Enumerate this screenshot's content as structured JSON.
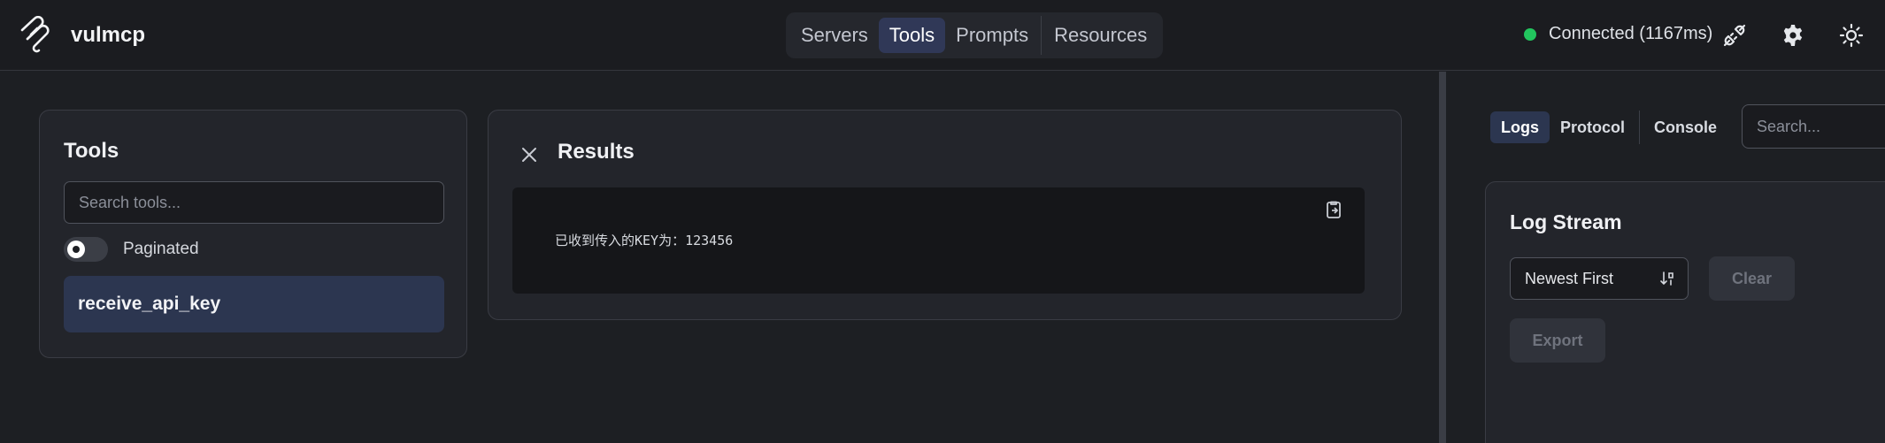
{
  "app": {
    "name": "vulmcp"
  },
  "nav": {
    "tabs": [
      {
        "label": "Servers"
      },
      {
        "label": "Tools"
      },
      {
        "label": "Prompts"
      },
      {
        "label": "Resources"
      }
    ],
    "active": "Tools"
  },
  "status": {
    "text": "Connected (1167ms)",
    "color": "#22c55e"
  },
  "header_icons": [
    "plug-icon",
    "gear-icon",
    "sun-icon"
  ],
  "tools": {
    "title": "Tools",
    "search_placeholder": "Search tools...",
    "paginated_label": "Paginated",
    "items": [
      {
        "name": "receive_api_key"
      }
    ]
  },
  "results": {
    "title": "Results",
    "text": "已收到传入的KEY为：123456"
  },
  "logs": {
    "tabs": [
      {
        "label": "Logs"
      },
      {
        "label": "Protocol"
      },
      {
        "label": "Console"
      }
    ],
    "active": "Logs",
    "search_placeholder": "Search...",
    "stream_title": "Log Stream",
    "sort_value": "Newest First",
    "clear_label": "Clear",
    "export_label": "Export"
  },
  "colors": {
    "accent": "#303857",
    "selected_item": "#2c3650",
    "background": "#1d1f23"
  }
}
